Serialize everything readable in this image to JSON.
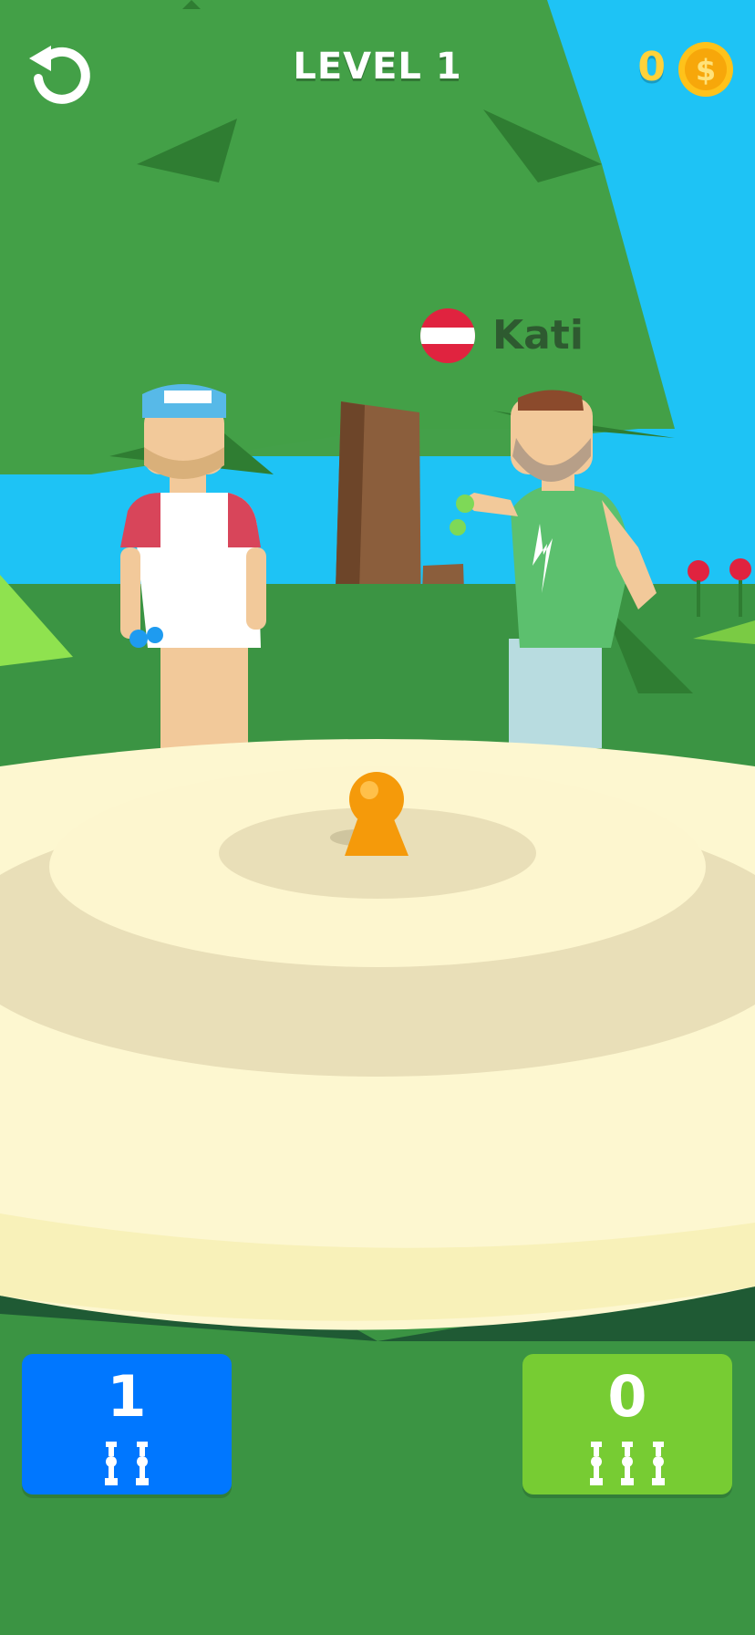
{
  "hud": {
    "level_label": "LEVEL 1",
    "coins": "0",
    "coin_symbol": "$",
    "restart_icon": "restart-icon"
  },
  "opponent": {
    "name": "Kati",
    "flag_icon": "austria-flag-icon"
  },
  "scores": {
    "player": {
      "value": "1",
      "pins_remaining": 2,
      "color": "#0077ff"
    },
    "opponent": {
      "value": "0",
      "pins_remaining": 3,
      "color": "#77cc33"
    }
  },
  "colors": {
    "sky": "#1ec3f5",
    "tree": "#44a049",
    "grass": "#3b9443",
    "arena_light": "#fdf7d0",
    "arena_ring": "#e9dfb8",
    "target_ball": "#f59a0a",
    "coin": "#ffc21a"
  }
}
